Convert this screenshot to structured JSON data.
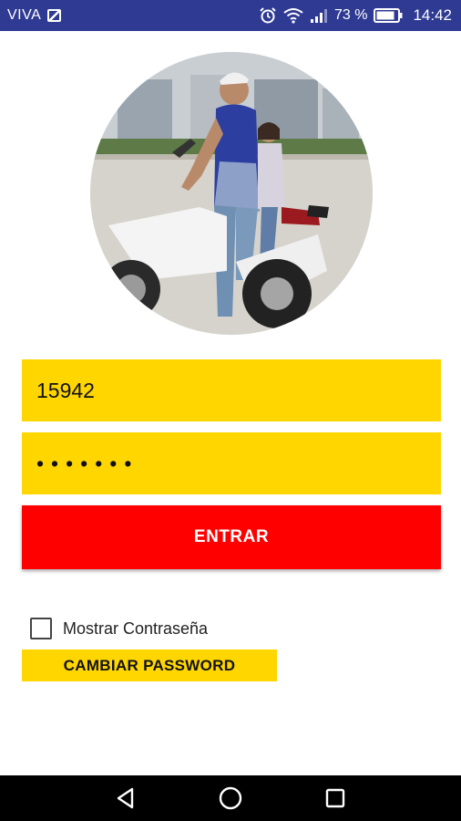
{
  "status_bar": {
    "carrier": "VIVA",
    "battery_percent": "73 %",
    "time": "14:42",
    "icons": [
      "sim-icon",
      "alarm-icon",
      "wifi-icon",
      "signal-icon",
      "battery-icon"
    ]
  },
  "login": {
    "username_value": "15942",
    "password_value": "•••••••",
    "enter_label": "ENTRAR",
    "show_password_label": "Mostrar Contraseña",
    "show_password_checked": false,
    "change_password_label": "CAMBIAR PASSWORD"
  },
  "colors": {
    "status_bar": "#2f3a93",
    "field_bg": "#ffd600",
    "enter_bg": "#ff0000",
    "nav_bar": "#000000"
  },
  "nav_bar": {
    "buttons": [
      "back-icon",
      "home-icon",
      "recents-icon"
    ]
  }
}
